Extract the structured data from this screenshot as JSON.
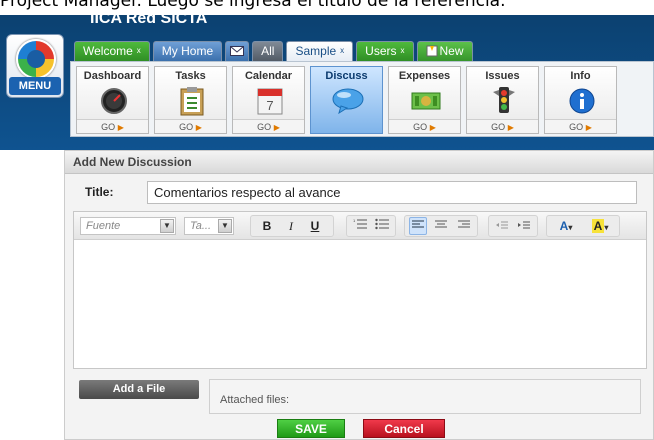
{
  "caption": "Project Manager. Luego se ingresa el título de la referencia.",
  "app": {
    "title": "IICA Red SICTA",
    "menu_label": "MENU"
  },
  "top_tabs": {
    "welcome": "Welcome",
    "my_home": "My Home",
    "all": "All",
    "sample": "Sample",
    "users": "Users",
    "new": "New",
    "close_glyph": "x"
  },
  "modules": [
    {
      "name": "Dashboard",
      "go": "GO"
    },
    {
      "name": "Tasks",
      "go": "GO"
    },
    {
      "name": "Calendar",
      "go": "GO",
      "day": "7"
    },
    {
      "name": "Discuss",
      "go": ""
    },
    {
      "name": "Expenses",
      "go": "GO"
    },
    {
      "name": "Issues",
      "go": "GO"
    },
    {
      "name": "Info",
      "go": "GO"
    }
  ],
  "panel": {
    "heading": "Add New Discussion",
    "title_label": "Title:",
    "title_value": "Comentarios respecto al avance"
  },
  "editor": {
    "font_placeholder": "Fuente",
    "size_placeholder": "Ta...",
    "bold": "B",
    "italic": "I",
    "underline": "U",
    "font_color": "A",
    "highlight": "A"
  },
  "attachments": {
    "add_button": "Add a File",
    "label": "Attached files:"
  },
  "actions": {
    "save": "SAVE",
    "cancel": "Cancel"
  },
  "colors": {
    "header": "#0d4a80",
    "save": "#1f9a17",
    "cancel": "#b8111e",
    "active_module": "#7fb4ea"
  }
}
